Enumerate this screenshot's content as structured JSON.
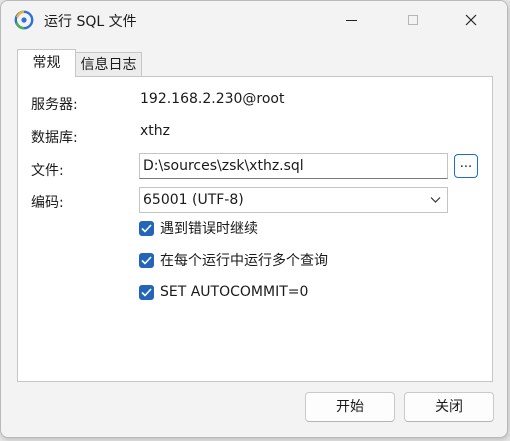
{
  "window": {
    "title": "运行 SQL 文件",
    "app_icon": "app-logo-icon"
  },
  "tabs": [
    {
      "label": "常规",
      "active": true
    },
    {
      "label": "信息日志",
      "active": false
    }
  ],
  "form": {
    "server_label": "服务器:",
    "server_value": "192.168.2.230@root",
    "database_label": "数据库:",
    "database_value": "xthz",
    "file_label": "文件:",
    "file_value": "D:\\sources\\zsk\\xthz.sql",
    "browse_label": "...",
    "encoding_label": "编码:",
    "encoding_value": "65001 (UTF-8)"
  },
  "options": [
    {
      "label": "遇到错误时继续",
      "checked": true
    },
    {
      "label": "在每个运行中运行多个查询",
      "checked": true
    },
    {
      "label": "SET AUTOCOMMIT=0",
      "checked": true
    }
  ],
  "footer": {
    "start_label": "开始",
    "close_label": "关闭"
  },
  "colors": {
    "accent": "#2366b8",
    "window_bg": "#f3f3f3",
    "panel_bg": "#ffffff"
  }
}
